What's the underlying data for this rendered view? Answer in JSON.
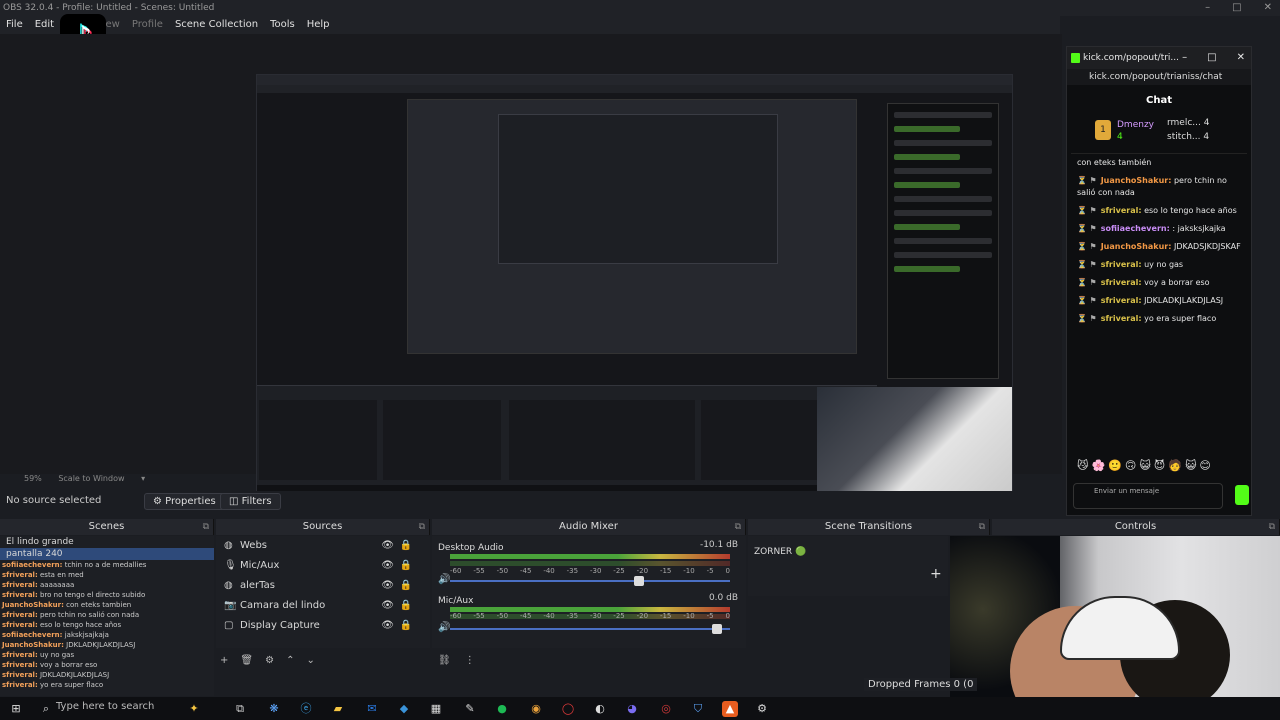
{
  "window": {
    "title": "OBS 32.0.4 - Profile: Untitled - Scenes: Untitled",
    "controls": [
      "–",
      "□",
      "✕"
    ]
  },
  "menu": {
    "items": [
      "File",
      "Edit",
      "View",
      "Profile",
      "Scene Collection",
      "Tools",
      "Help"
    ]
  },
  "preview": {
    "zoom": "59%",
    "scale_mode": "Scale to Window"
  },
  "source_toolbar": {
    "no_source": "No source selected",
    "properties": "Properties",
    "filters": "Filters"
  },
  "docks": {
    "scenes": "Scenes",
    "sources": "Sources",
    "audio_mixer": "Audio Mixer",
    "scene_transitions": "Scene Transitions",
    "controls": "Controls"
  },
  "scenes": [
    "El lindo grande",
    "pantalla 240"
  ],
  "scene_chat_overlay": [
    {
      "user": "sofiiaechevern:",
      "text": "tchin no a de medallies"
    },
    {
      "user": "sfriveral:",
      "text": "esta en med"
    },
    {
      "user": "sfriveral:",
      "text": "aaaaaaaa"
    },
    {
      "user": "sfriveral:",
      "text": "bro no tengo el directo subido"
    },
    {
      "user": "JuanchoShakur:",
      "text": "con eteks tambien"
    },
    {
      "user": "sfriveral:",
      "text": "pero tchin no salió con nada"
    },
    {
      "user": "sfriveral:",
      "text": "eso lo tengo hace años"
    },
    {
      "user": "sofiiaechevern:",
      "text": "jakskjsajkaja"
    },
    {
      "user": "JuanchoShakur:",
      "text": "JDKLADKJLAKDJLASJ"
    },
    {
      "user": "sfriveral:",
      "text": "uy no gas"
    },
    {
      "user": "sfriveral:",
      "text": "voy a borrar eso"
    },
    {
      "user": "sfriveral:",
      "text": "JDKLADKJLAKDJLASJ"
    },
    {
      "user": "sfriveral:",
      "text": "yo era super flaco"
    }
  ],
  "sources": [
    {
      "name": "Webs",
      "icon": "globe-icon"
    },
    {
      "name": "Mic/Aux",
      "icon": "mic-icon"
    },
    {
      "name": "alerTas",
      "icon": "globe-icon"
    },
    {
      "name": "Camara del lindo",
      "icon": "camera-icon"
    },
    {
      "name": "Display Capture",
      "icon": "monitor-icon"
    }
  ],
  "mixer": {
    "channels": [
      {
        "name": "Desktop Audio",
        "db": "-10.1 dB",
        "fader": 0.68
      },
      {
        "name": "Mic/Aux",
        "db": "0.0 dB",
        "fader": 0.97
      }
    ],
    "ticks": [
      "-60",
      "-55",
      "-50",
      "-45",
      "-40",
      "-35",
      "-30",
      "-25",
      "-20",
      "-15",
      "-10",
      "-5",
      "0"
    ]
  },
  "transitions": {
    "current": "ZORNER 🟢",
    "add": "+"
  },
  "status": {
    "dropped": "Dropped Frames 0 (0"
  },
  "kick": {
    "tab_title": "kick.com/popout/tri...",
    "url": "kick.com/popout/trianiss/chat",
    "chat_title": "Chat",
    "pinned": {
      "badge": "1",
      "name": "Dmenzy",
      "count": "4",
      "right": [
        "rmelc... 4",
        "stitch... 4"
      ]
    },
    "messages": [
      {
        "user": "",
        "text": "con eteks también"
      },
      {
        "user": "JuanchoShakur:",
        "text": "pero tchin no salió con nada",
        "cls": "u"
      },
      {
        "user": "sfriveral:",
        "text": "eso lo tengo hace años",
        "cls": "u2"
      },
      {
        "user": "sofiiaechevern:",
        "text": ": jaksksjkajka",
        "cls": "u3"
      },
      {
        "user": "JuanchoShakur:",
        "text": "JDKADSJKDJSKAF",
        "cls": "u"
      },
      {
        "user": "sfriveral:",
        "text": "uy no gas",
        "cls": "u2"
      },
      {
        "user": "sfriveral:",
        "text": "voy a borrar eso",
        "cls": "u2"
      },
      {
        "user": "sfriveral:",
        "text": "JDKLADKJLAKDJLASJ",
        "cls": "u2"
      },
      {
        "user": "sfriveral:",
        "text": "yo era super flaco",
        "cls": "u2"
      }
    ],
    "input_placeholder": "Enviar un mensaje"
  },
  "taskbar": {
    "search": "Type here to search"
  },
  "colors": {
    "kick_green": "#53fc18",
    "obs_bg": "#1d1f24",
    "selection": "#2e4a7a"
  }
}
